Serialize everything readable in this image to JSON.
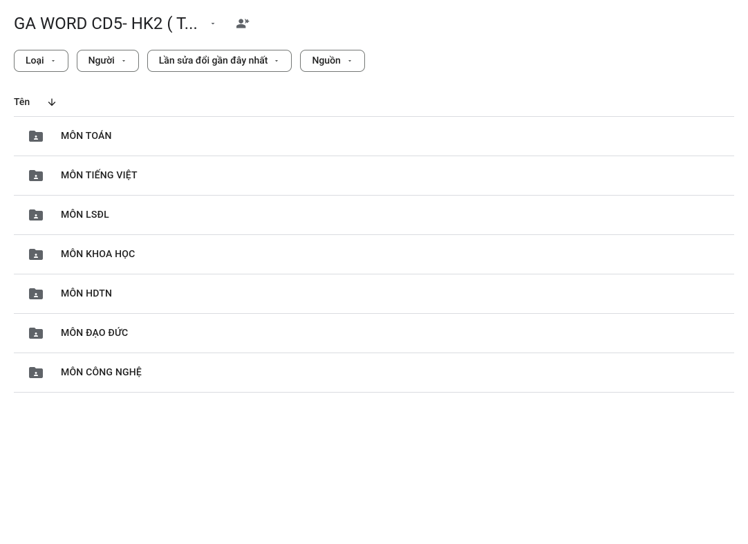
{
  "header": {
    "title": "GA WORD CD5- HK2 ( T..."
  },
  "filters": {
    "type": "Loại",
    "people": "Người",
    "modified": "Lần sửa đổi gần đây nhất",
    "source": "Nguồn"
  },
  "columns": {
    "name": "Tên"
  },
  "folders": [
    {
      "name": "MÔN TOÁN"
    },
    {
      "name": "MÔN TIẾNG VIỆT"
    },
    {
      "name": "MÔN LSĐL"
    },
    {
      "name": "MÔN KHOA HỌC"
    },
    {
      "name": "MÔN HDTN"
    },
    {
      "name": "MÔN ĐẠO ĐỨC"
    },
    {
      "name": "MÔN CÔNG NGHỆ"
    }
  ]
}
